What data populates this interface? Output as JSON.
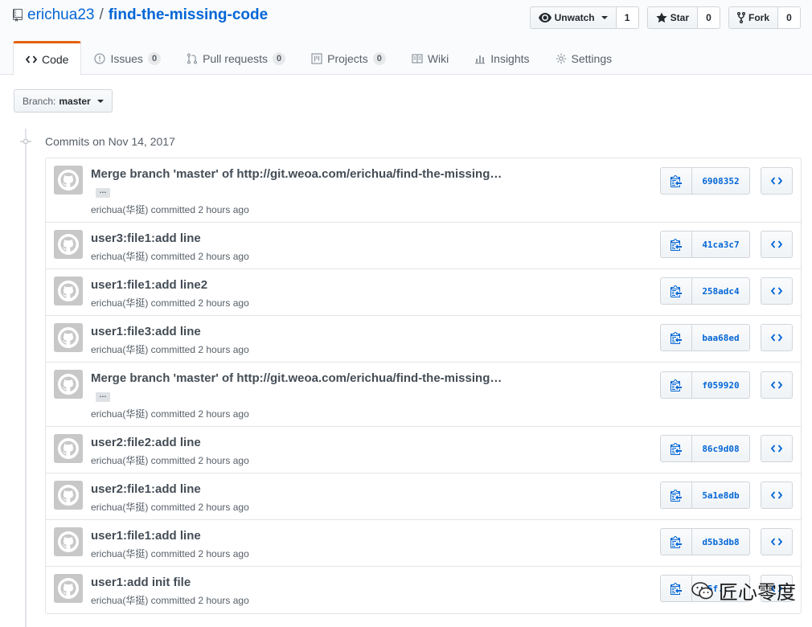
{
  "repo": {
    "owner": "erichua23",
    "separator": "/",
    "name": "find-the-missing-code"
  },
  "actions": {
    "watch": {
      "label": "Unwatch",
      "count": "1"
    },
    "star": {
      "label": "Star",
      "count": "0"
    },
    "fork": {
      "label": "Fork",
      "count": "0"
    }
  },
  "tabs": [
    {
      "label": "Code",
      "icon": "code-icon"
    },
    {
      "label": "Issues",
      "count": "0",
      "icon": "issue-icon"
    },
    {
      "label": "Pull requests",
      "count": "0",
      "icon": "pull-request-icon"
    },
    {
      "label": "Projects",
      "count": "0",
      "icon": "project-icon"
    },
    {
      "label": "Wiki",
      "icon": "book-icon"
    },
    {
      "label": "Insights",
      "icon": "graph-icon"
    },
    {
      "label": "Settings",
      "icon": "gear-icon"
    }
  ],
  "branch": {
    "label": "Branch:",
    "value": "master"
  },
  "commits_date": "Commits on Nov 14, 2017",
  "commits": [
    {
      "message": "Merge branch 'master' of http://git.weoa.com/erichua/find-the-missing…",
      "expand": "…",
      "author": "erichua(华挺) committed 2 hours ago",
      "sha": "6908352"
    },
    {
      "message": "user3:file1:add line",
      "author": "erichua(华挺) committed 2 hours ago",
      "sha": "41ca3c7"
    },
    {
      "message": "user1:file1:add line2",
      "author": "erichua(华挺) committed 2 hours ago",
      "sha": "258adc4"
    },
    {
      "message": "user1:file3:add line",
      "author": "erichua(华挺) committed 2 hours ago",
      "sha": "baa68ed"
    },
    {
      "message": "Merge branch 'master' of http://git.weoa.com/erichua/find-the-missing…",
      "expand": "…",
      "author": "erichua(华挺) committed 2 hours ago",
      "sha": "f059920"
    },
    {
      "message": "user2:file2:add line",
      "author": "erichua(华挺) committed 2 hours ago",
      "sha": "86c9d08"
    },
    {
      "message": "user2:file1:add line",
      "author": "erichua(华挺) committed 2 hours ago",
      "sha": "5a1e8db"
    },
    {
      "message": "user1:file1:add line",
      "author": "erichua(华挺) committed 2 hours ago",
      "sha": "d5b3db8"
    },
    {
      "message": "user1:add init file",
      "author": "erichua(华挺) committed 2 hours ago",
      "sha": "5f..."
    }
  ],
  "watermark": "匠心零度",
  "colors": {
    "link": "#0366d6",
    "tab_accent": "#e36209",
    "border": "#e1e4e8",
    "muted": "#586069"
  }
}
